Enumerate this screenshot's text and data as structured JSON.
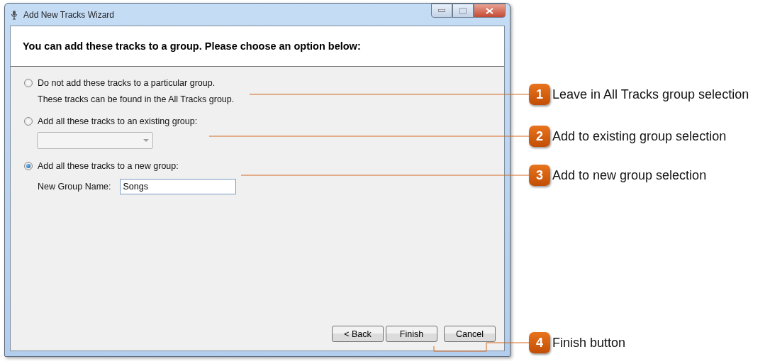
{
  "window": {
    "title": "Add New Tracks Wizard"
  },
  "header": "You can add these tracks to a group. Please choose an option below:",
  "options": [
    {
      "kind": "note",
      "label": "Do not add these tracks to a particular group.",
      "selected": false,
      "note": "These tracks can be found in the All Tracks group."
    },
    {
      "kind": "dropdown",
      "label": "Add all these tracks to an existing group:",
      "selected": false
    },
    {
      "kind": "field",
      "label": "Add all these tracks to a new group:",
      "selected": true,
      "field_label": "New Group Name:",
      "value": "Songs"
    }
  ],
  "buttons": [
    "< Back",
    "Finish",
    "Cancel"
  ],
  "callouts": [
    {
      "number": "1",
      "text": "Leave in All Tracks group selection"
    },
    {
      "number": "2",
      "text": "Add to existing group selection"
    },
    {
      "number": "3",
      "text": "Add to new group selection"
    },
    {
      "number": "4",
      "text": "Finish button"
    }
  ]
}
